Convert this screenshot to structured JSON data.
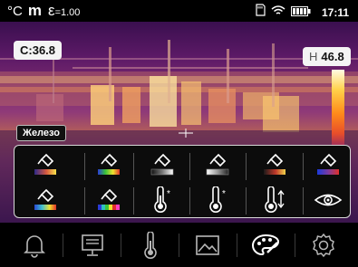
{
  "status": {
    "temp_unit": "°C",
    "mode": "m",
    "emissivity_symbol": "ε",
    "emissivity_value": "=1.00",
    "time": "17:11"
  },
  "measurements": {
    "center_label": "C:36.8",
    "high_letter": "H",
    "high_value": "46.8"
  },
  "palette": {
    "selected_name": "Железо",
    "row1": [
      {
        "icon": "palette-iron-icon",
        "colors": [
          "#2e2a8a",
          "#d85a40",
          "#f8e24a"
        ]
      },
      {
        "icon": "palette-rainbow-icon",
        "colors": [
          "#2a3bd6",
          "#3ac43a",
          "#f0e030",
          "#e0302a"
        ]
      },
      {
        "icon": "palette-white-hot-icon",
        "colors": [
          "#111111",
          "#777777",
          "#ffffff"
        ]
      },
      {
        "icon": "palette-black-hot-icon",
        "colors": [
          "#ffffff",
          "#777777",
          "#111111"
        ]
      },
      {
        "icon": "palette-red-hot-icon",
        "colors": [
          "#1a1a1a",
          "#c0392b",
          "#f0d24a"
        ]
      },
      {
        "icon": "palette-cold-hot-icon",
        "colors": [
          "#1a3adb",
          "#7a3aa0",
          "#e0302a"
        ]
      }
    ],
    "row2": [
      {
        "icon": "palette-lava-icon",
        "colors": [
          "#2a4ad6",
          "#40c0d0",
          "#f0e030",
          "#e0302a"
        ]
      },
      {
        "icon": "palette-rainbow-hc-icon",
        "colors": [
          "#2a3bd6",
          "#30c0c0",
          "#3ac43a",
          "#f0e030",
          "#e0302a",
          "#ff40c0"
        ]
      },
      {
        "icon": "thermometer-high-alarm-icon"
      },
      {
        "icon": "thermometer-low-alarm-icon"
      },
      {
        "icon": "thermometer-range-icon"
      },
      {
        "icon": "eye-visibility-icon"
      }
    ]
  },
  "bottom_bar": [
    {
      "icon": "bell-alarm-icon"
    },
    {
      "icon": "monitor-display-icon"
    },
    {
      "icon": "thermometer-icon"
    },
    {
      "icon": "image-gallery-icon"
    },
    {
      "icon": "palette-icon",
      "active": true
    },
    {
      "icon": "settings-gear-icon"
    }
  ],
  "colors": {
    "scale_top": "#fffbe4",
    "scale_mid": "#ff8a1a",
    "scale_bottom": "#8a2468",
    "active_icon": "#ffffff",
    "inactive_icon": "#b8b8b8"
  }
}
